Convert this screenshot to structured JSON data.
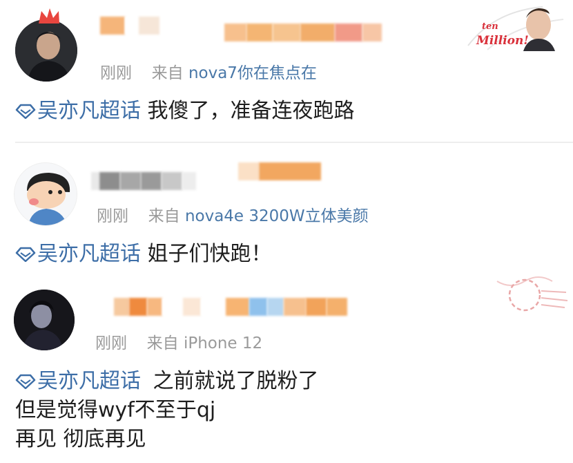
{
  "posts": [
    {
      "time": "刚刚",
      "from_prefix": "来自",
      "source": "nova7你在焦点在",
      "topic": "吴亦凡超话",
      "lines": [
        "我傻了，准备连夜跑路"
      ],
      "badge_text": "ten Million!"
    },
    {
      "time": "刚刚",
      "from_prefix": "来自",
      "source": "nova4e 3200W立体美颜",
      "topic": "吴亦凡超话",
      "lines": [
        "姐子们快跑！"
      ]
    },
    {
      "time": "刚刚",
      "from_prefix": "来自",
      "source": "iPhone 12",
      "topic": "吴亦凡超话",
      "lines": [
        "之前就说了脱粉了",
        "但是觉得wyf不至于qj",
        "再见 彻底再见"
      ]
    }
  ],
  "colors": {
    "topic": "#3d6ea7",
    "meta": "#9a9a9a",
    "text": "#1e1e1e",
    "blur_orange": "#f2a35a",
    "blur_blue": "#8fc1ec"
  }
}
